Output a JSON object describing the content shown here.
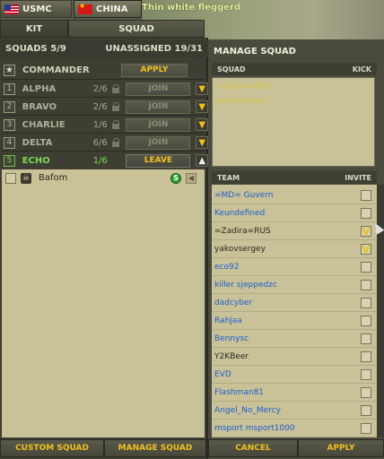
{
  "factions": [
    {
      "label": "USMC",
      "flag": "us-flag-icon"
    },
    {
      "label": "CHINA",
      "flag": "china-flag-icon"
    }
  ],
  "chat": {
    "text": "Thin white fleggerd"
  },
  "tabs": {
    "kit": "KIT",
    "squad": "SQUAD"
  },
  "squads_header": {
    "left": "SQUADS 5/9",
    "right": "UNASSIGNED 19/31"
  },
  "commander": {
    "label": "COMMANDER",
    "button": "APPLY"
  },
  "squads": [
    {
      "num": "1",
      "name": "ALPHA",
      "count": "2/6",
      "button": "JOIN"
    },
    {
      "num": "2",
      "name": "BRAVO",
      "count": "2/6",
      "button": "JOIN"
    },
    {
      "num": "3",
      "name": "CHARLIE",
      "count": "1/6",
      "button": "JOIN"
    },
    {
      "num": "4",
      "name": "DELTA",
      "count": "6/6",
      "button": "JOIN"
    },
    {
      "num": "5",
      "name": "ECHO",
      "count": "1/6",
      "button": "LEAVE"
    }
  ],
  "squad_member": {
    "name": "Bafom",
    "badge": "S"
  },
  "bottom_left": {
    "custom": "CUSTOM SQUAD",
    "manage": "MANAGE SQUAD"
  },
  "manage": {
    "title": "MANAGE SQUAD",
    "squad_col": "SQUAD",
    "kick_col": "KICK",
    "squad_members": [
      "=Zadira=RUS",
      "yakovsergey"
    ],
    "team_col": "TEAM",
    "invite_col": "INVITE",
    "team": [
      {
        "name": "=MD= Guvern",
        "checked": false,
        "blue": true
      },
      {
        "name": "Keundefined",
        "checked": false,
        "blue": true
      },
      {
        "name": "=Zadira=RUS",
        "checked": true,
        "blue": false
      },
      {
        "name": "yakovsergey",
        "checked": true,
        "blue": false
      },
      {
        "name": "eco92",
        "checked": false,
        "blue": true
      },
      {
        "name": "killer sjeppedzc",
        "checked": false,
        "blue": true
      },
      {
        "name": "dadcyber",
        "checked": false,
        "blue": true
      },
      {
        "name": "Rahjaa",
        "checked": false,
        "blue": true
      },
      {
        "name": "Bennysc",
        "checked": false,
        "blue": true
      },
      {
        "name": "Y2KBeer",
        "checked": false,
        "blue": false
      },
      {
        "name": "EVD",
        "checked": false,
        "blue": true
      },
      {
        "name": "Flashman81",
        "checked": false,
        "blue": true
      },
      {
        "name": "Angel_No_Mercy",
        "checked": false,
        "blue": true
      },
      {
        "name": "msport msport1000",
        "checked": false,
        "blue": true
      }
    ],
    "cancel": "CANCEL",
    "apply": "APPLY"
  },
  "check_mark": "V",
  "colors": {
    "accent": "#f0c020",
    "panel": "#c9c197",
    "link": "#1c5fd0"
  }
}
